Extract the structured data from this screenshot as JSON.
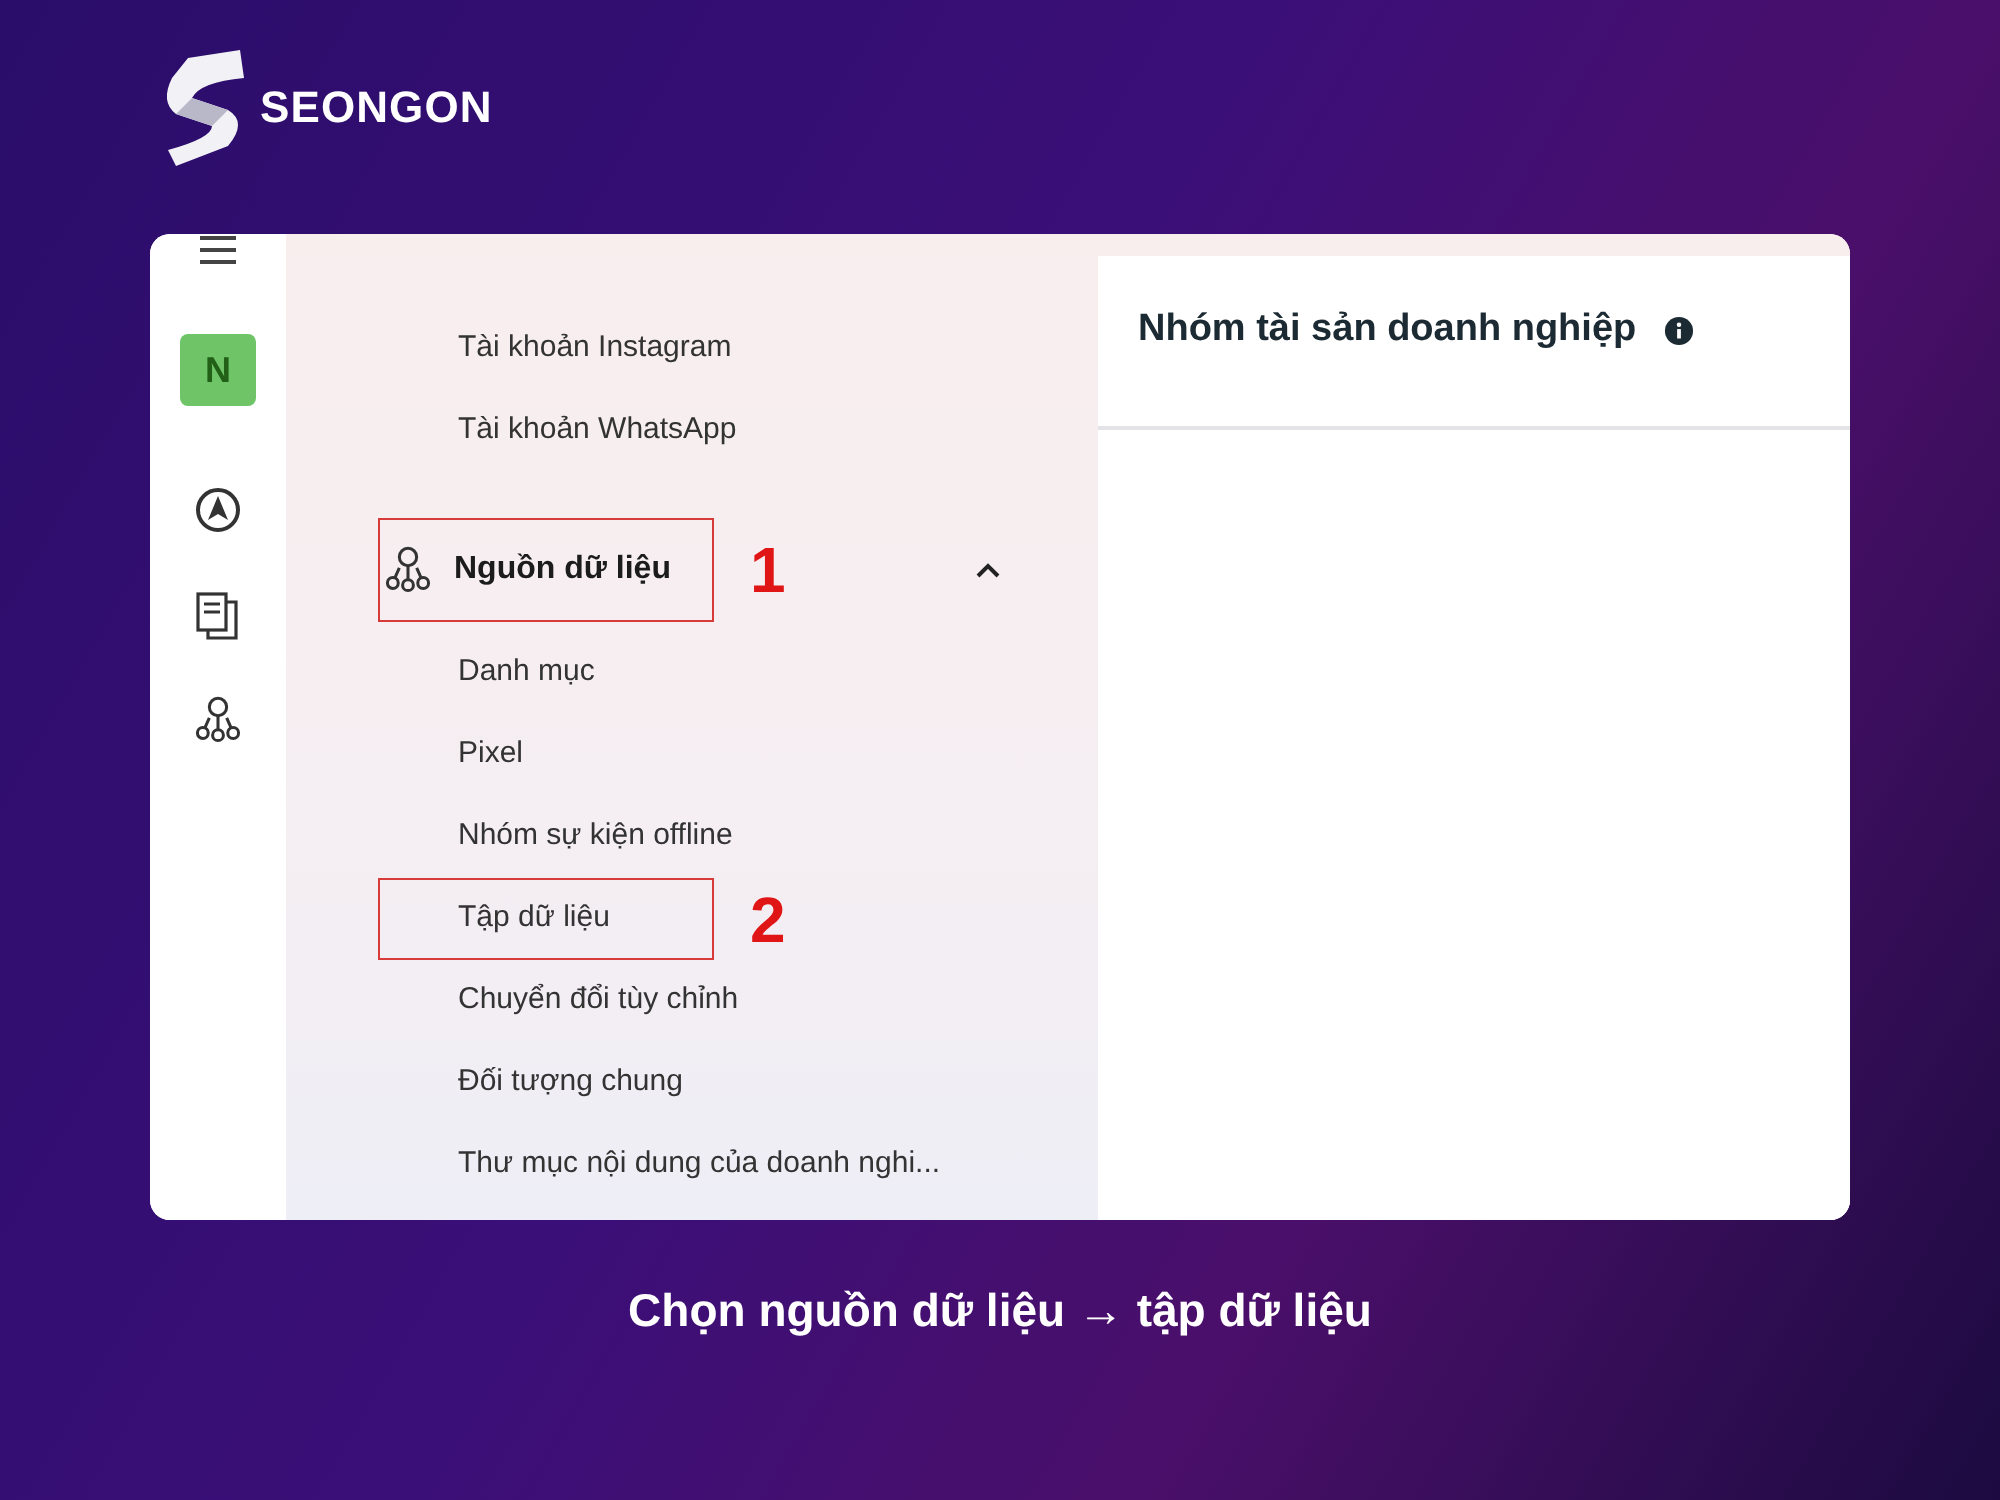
{
  "brand": {
    "name": "SEONGON"
  },
  "sidebar": {
    "items": [
      {
        "label": "Tài khoản Instagram"
      },
      {
        "label": "Tài khoản WhatsApp"
      }
    ],
    "group": {
      "label": "Nguồn dữ liệu",
      "expanded": true,
      "annotation": "1",
      "children": [
        {
          "label": "Danh mục"
        },
        {
          "label": "Pixel"
        },
        {
          "label": "Nhóm sự kiện offline"
        },
        {
          "label": "Tập dữ liệu",
          "annotation": "2"
        },
        {
          "label": "Chuyển đổi tùy chỉnh"
        },
        {
          "label": "Đối tượng chung"
        },
        {
          "label": "Thư mục nội dung của doanh nghi..."
        }
      ]
    }
  },
  "rail": {
    "avatar": "N"
  },
  "main": {
    "title": "Nhóm tài sản doanh nghiệp"
  },
  "caption": "Chọn nguồn dữ liệu → tập dữ liệu"
}
